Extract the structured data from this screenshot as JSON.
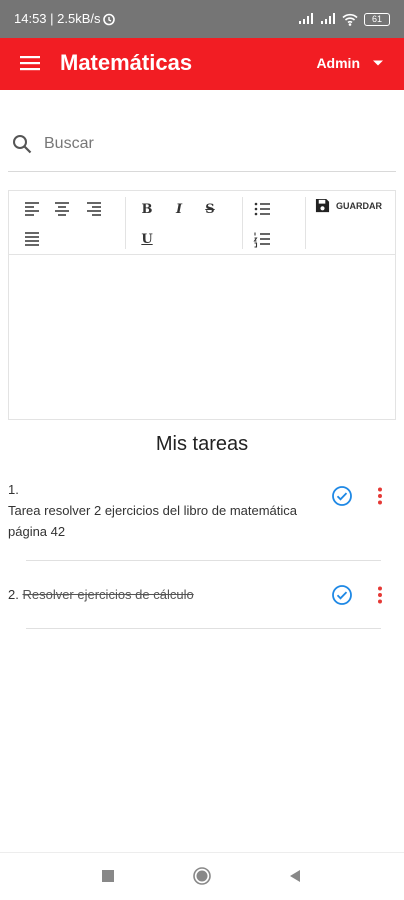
{
  "status_bar": {
    "text": "14:53 | 2.5kB/s",
    "battery": "61",
    "icons": [
      "alarm-icon",
      "signal-icon",
      "signal-icon",
      "wifi-icon",
      "battery-icon"
    ]
  },
  "app_bar": {
    "title": "Matemáticas",
    "user": "Admin",
    "menu_icon": "menu-icon",
    "dropdown_icon": "caret-down-icon",
    "color": "#f21d23"
  },
  "search": {
    "placeholder": "Buscar",
    "value": ""
  },
  "editor": {
    "toolbar": {
      "bold": "B",
      "italic": "I",
      "strike": "S",
      "underline": "U",
      "save_label": "GUARDAR"
    },
    "content": ""
  },
  "tasks": {
    "title": "Mis tareas",
    "items": [
      {
        "number": "1.",
        "text": "Tarea resolver 2 ejercicios del libro de matemática página 42",
        "done": false
      },
      {
        "number": "2.",
        "text": "Resolver ejercicios de cálculo",
        "done": true
      }
    ],
    "check_color": "#1e88e5",
    "menu_color": "#e53935"
  },
  "nav_bar": {
    "icons": [
      "recent-apps-icon",
      "home-icon",
      "back-icon"
    ]
  }
}
